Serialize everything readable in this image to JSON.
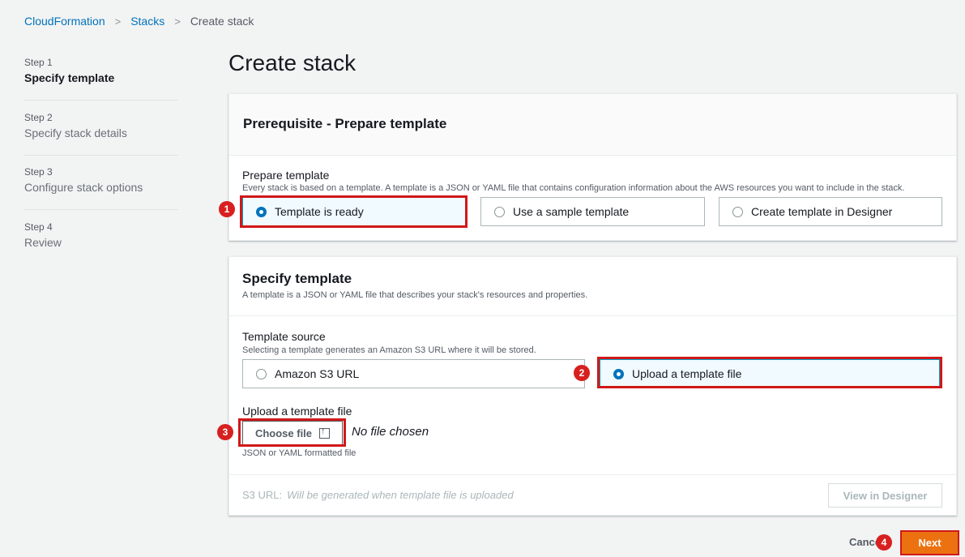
{
  "breadcrumb": {
    "items": [
      "CloudFormation",
      "Stacks"
    ],
    "current": "Create stack",
    "separator": ">"
  },
  "steps": [
    {
      "num": "Step 1",
      "title": "Specify template",
      "active": true
    },
    {
      "num": "Step 2",
      "title": "Specify stack details",
      "active": false
    },
    {
      "num": "Step 3",
      "title": "Configure stack options",
      "active": false
    },
    {
      "num": "Step 4",
      "title": "Review",
      "active": false
    }
  ],
  "page_title": "Create stack",
  "prerequisite": {
    "header": "Prerequisite - Prepare template",
    "label": "Prepare template",
    "description": "Every stack is based on a template. A template is a JSON or YAML file that contains configuration information about the AWS resources you want to include in the stack.",
    "options": [
      {
        "label": "Template is ready",
        "selected": true
      },
      {
        "label": "Use a sample template",
        "selected": false
      },
      {
        "label": "Create template in Designer",
        "selected": false
      }
    ]
  },
  "specify": {
    "header": "Specify template",
    "description": "A template is a JSON or YAML file that describes your stack's resources and properties.",
    "source_label": "Template source",
    "source_description": "Selecting a template generates an Amazon S3 URL where it will be stored.",
    "source_options": [
      {
        "label": "Amazon S3 URL",
        "selected": false
      },
      {
        "label": "Upload a template file",
        "selected": true
      }
    ],
    "upload_label": "Upload a template file",
    "choose_file": "Choose file",
    "no_file": "No file chosen",
    "upload_hint": "JSON or YAML formatted file",
    "s3_url_label": "S3 URL:",
    "s3_url_placeholder": "Will be generated when template file is uploaded",
    "view_designer": "View in Designer"
  },
  "footer": {
    "cancel": "Cancel",
    "next": "Next"
  },
  "markers": [
    "1",
    "2",
    "3",
    "4"
  ],
  "colors": {
    "link": "#0073bb",
    "primary_button": "#ec7211",
    "highlight": "#d01818",
    "selected_radio": "#0073bb"
  }
}
